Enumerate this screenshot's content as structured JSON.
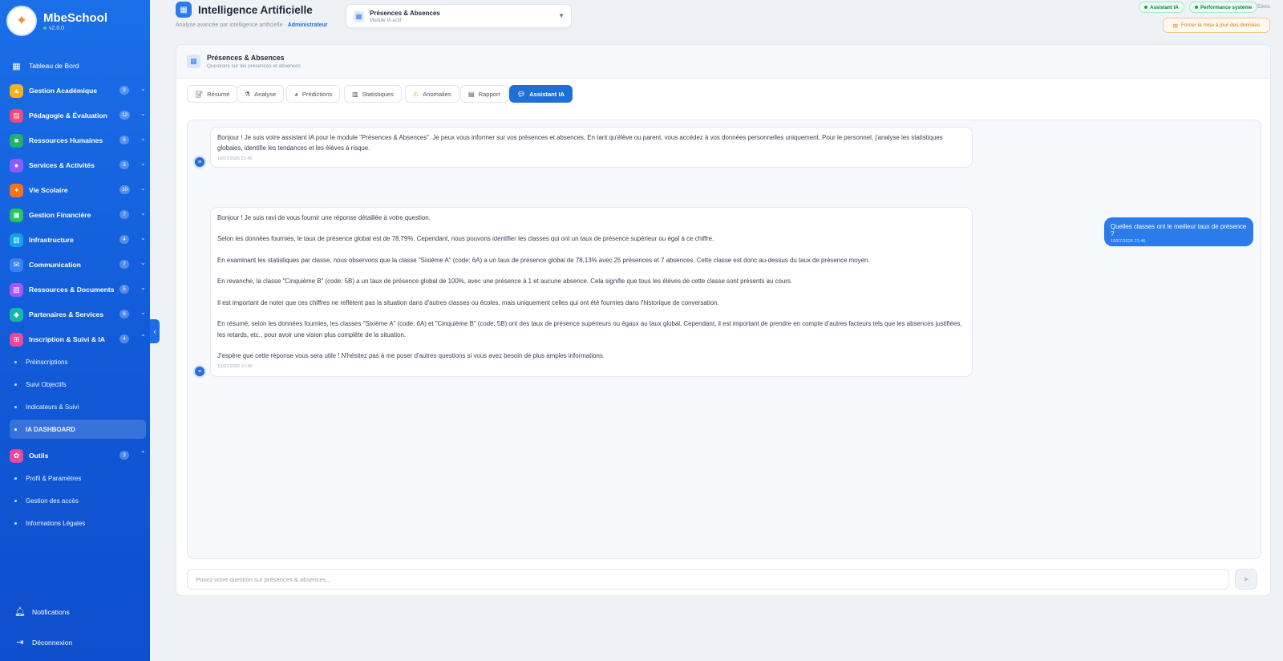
{
  "brand": {
    "name": "MbeSchool",
    "version": "v2.0.0"
  },
  "sidebar": {
    "dashboard": {
      "label": "Tableau de Bord",
      "icon": "dashboard-icon"
    },
    "groups": [
      {
        "label": "Gestion Académique",
        "count": "9",
        "color": "#f5b21b",
        "icon": "graduation-cap-icon"
      },
      {
        "label": "Pédagogie & Évaluation",
        "count": "12",
        "color": "#f0467a",
        "icon": "clipboard-icon"
      },
      {
        "label": "Ressources Humaines",
        "count": "6",
        "color": "#1fb36b",
        "icon": "briefcase-icon"
      },
      {
        "label": "Services & Activités",
        "count": "3",
        "color": "#8b5cf6",
        "icon": "activity-icon"
      },
      {
        "label": "Vie Scolaire",
        "count": "10",
        "color": "#f97316",
        "icon": "running-person-icon"
      },
      {
        "label": "Gestion Financière",
        "count": "7",
        "color": "#22c55e",
        "icon": "finance-icon"
      },
      {
        "label": "Infrastructure",
        "count": "4",
        "color": "#0ea5e9",
        "icon": "building-icon"
      },
      {
        "label": "Communication",
        "count": "7",
        "color": "#3b82f6",
        "icon": "mail-icon"
      },
      {
        "label": "Ressources & Documents",
        "count": "5",
        "color": "#a855f7",
        "icon": "document-icon"
      },
      {
        "label": "Partenaires & Services",
        "count": "6",
        "color": "#14b8a6",
        "icon": "handshake-icon"
      },
      {
        "label": "Inscription & Suivi & IA",
        "count": "4",
        "color": "#ec4899",
        "icon": "grid-icon"
      }
    ],
    "inscription_items": [
      "Préinscriptions",
      "Suivi Objectifs",
      "Indicateurs & Suivi",
      "IA DASHBOARD"
    ],
    "tools": {
      "label": "Outils",
      "count": "3",
      "color": "#ec4899",
      "icon": "gear-icon"
    },
    "tools_items": [
      "Profil & Paramètres",
      "Gestion des accès",
      "Informations Légales"
    ],
    "notifications": "Notifications",
    "logout": "Déconnexion"
  },
  "header": {
    "title": "Intelligence Artificielle",
    "subtitle": "Analyse avancée par intelligence artificielle ·",
    "role": "Administrateur",
    "module_select": {
      "title": "Présences & Absences",
      "subtitle": "Module IA actif"
    },
    "status": {
      "assistant": "Assistant IA",
      "performance": "Performance système",
      "latency": "53ms"
    },
    "force_button": "Forcer la mise à jour des données"
  },
  "panel": {
    "title": "Présences & Absences",
    "subtitle": "Questions sur les présences et absences",
    "tabs": [
      {
        "label": "Résumé",
        "icon": "summary-icon"
      },
      {
        "label": "Analyse",
        "icon": "analysis-icon"
      },
      {
        "label": "Prédictions",
        "icon": "prediction-icon"
      },
      {
        "label": "Statistiques",
        "icon": "statistics-icon"
      },
      {
        "label": "Anomalies",
        "icon": "warning-icon"
      },
      {
        "label": "Rapport",
        "icon": "report-icon"
      },
      {
        "label": "Assistant IA",
        "icon": "chat-icon"
      }
    ]
  },
  "chat": {
    "messages": [
      {
        "role": "assistant",
        "lines": [
          "Bonjour ! Je suis votre assistant IA pour le module \"Présences & Absences\". Je peux vous informer sur vos présences et absences. En tant qu'élève ou parent, vous accédez à vos données personnelles uniquement. Pour le personnel, j'analyse les statistiques globales, identifie les tendances et les élèves à risque."
        ],
        "time": "19/07/2026 21:46"
      },
      {
        "role": "user",
        "text": "Quelles classes ont le meilleur taux de présence ?",
        "time": "19/07/2026 21:46"
      },
      {
        "role": "assistant",
        "paragraphs": [
          "Bonjour ! Je suis ravi de vous fournir une réponse détaillée à votre question.",
          "Selon les données fournies, le taux de présence global est de 78,79%. Cependant, nous pouvons identifier les classes qui ont un taux de présence supérieur ou égal à ce chiffre.",
          "En examinant les statistiques par classe, nous observons que la classe \"Sixième A\" (code: 6A) a un taux de présence global de 78,13% avec 25 présences et 7 absences. Cette classe est donc au-dessus du taux de présence moyen.",
          "En revanche, la classe \"Cinquième B\" (code: 5B) a un taux de présence global de 100%, avec une présence à 1 et aucune absence. Cela signifie que tous les élèves de cette classe sont présents au cours.",
          "Il est important de noter que ces chiffres ne reflètent pas la situation dans d'autres classes ou écoles, mais uniquement celles qui ont été fournies dans l'historique de conversation.",
          "En résumé, selon les données fournies, les classes \"Sixième A\" (code: 6A) et \"Cinquième B\" (code: 5B) ont des taux de présence supérieurs ou égaux au taux global. Cependant, il est important de prendre en compte d'autres facteurs tels que les absences justifiées, les retards, etc., pour avoir une vision plus complète de la situation.",
          "J'espère que cette réponse vous sera utile ! N'hésitez pas à me poser d'autres questions si vous avez besoin de plus amples informations."
        ],
        "time": "19/07/2026 21:46"
      }
    ],
    "input_placeholder": "Posez votre question sur présences & absences..."
  },
  "colors": {
    "accent": "#1f6fd9",
    "sidebar": "#1158d6",
    "success": "#16a34a",
    "warning": "#d9771f"
  }
}
